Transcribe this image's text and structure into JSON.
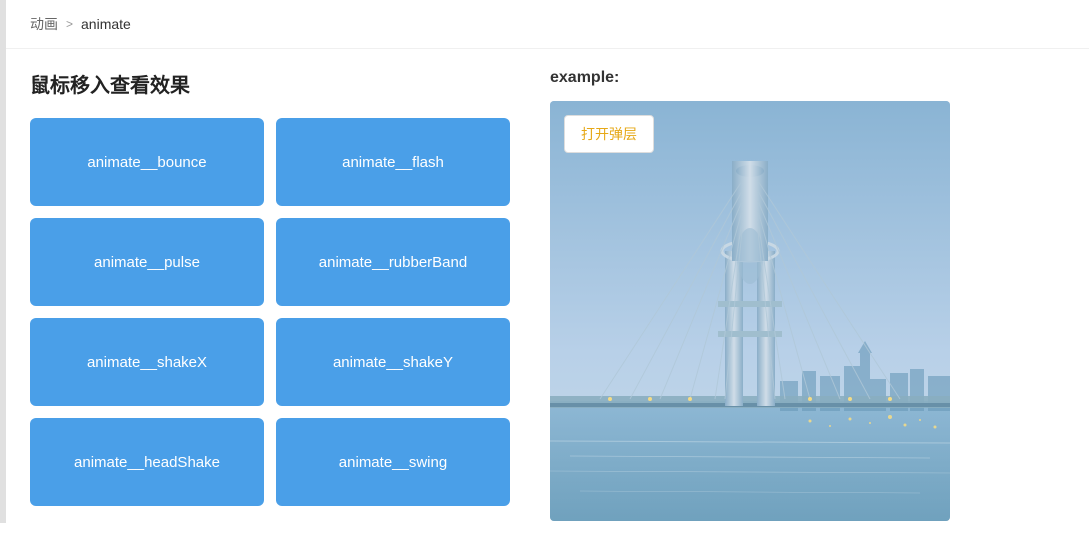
{
  "breadcrumb": {
    "parent": "动画",
    "separator": ">",
    "current": "animate"
  },
  "left": {
    "title": "鼠标移入查看效果",
    "buttons": [
      {
        "id": "bounce",
        "label": "animate__bounce"
      },
      {
        "id": "flash",
        "label": "animate__flash"
      },
      {
        "id": "pulse",
        "label": "animate__pulse"
      },
      {
        "id": "rubberBand",
        "label": "animate__rubberBand"
      },
      {
        "id": "shakeX",
        "label": "animate__shakeX"
      },
      {
        "id": "shakeY",
        "label": "animate__shakeY"
      },
      {
        "id": "headShake",
        "label": "animate__headShake"
      },
      {
        "id": "swing",
        "label": "animate__swing"
      }
    ]
  },
  "right": {
    "example_label": "example:",
    "open_popup_label": "打开弹层"
  },
  "colors": {
    "button_bg": "#4a9fe8",
    "button_hover": "#3a8fd8"
  }
}
